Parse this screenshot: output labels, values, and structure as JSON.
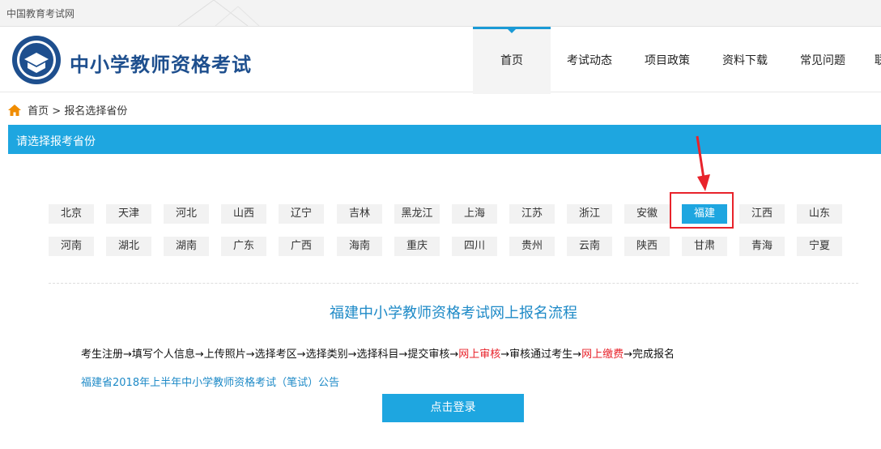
{
  "site_name": "中国教育考试网",
  "header": {
    "title": "中小学教师资格考试",
    "nav": [
      "首页",
      "考试动态",
      "项目政策",
      "资料下载",
      "常见问题",
      "联"
    ]
  },
  "breadcrumb": {
    "home": "首页",
    "sep": ">",
    "current": "报名选择省份"
  },
  "section_title": "请选择报考省份",
  "provinces_row1": [
    "北京",
    "天津",
    "河北",
    "山西",
    "辽宁",
    "吉林",
    "黑龙江",
    "上海",
    "江苏",
    "浙江",
    "安徽",
    "福建",
    "江西",
    "山东"
  ],
  "provinces_row2": [
    "河南",
    "湖北",
    "湖南",
    "广东",
    "广西",
    "海南",
    "重庆",
    "四川",
    "贵州",
    "云南",
    "陕西",
    "甘肃",
    "青海",
    "宁夏"
  ],
  "selected_province": "福建",
  "colors": {
    "accent": "#1ea6e0",
    "highlight": "#e8232b",
    "title_blue": "#1e4f8e"
  },
  "flow": {
    "title": "福建中小学教师资格考试网上报名流程",
    "part1": "考生注册→填写个人信息→上传照片→选择考区→选择类别→选择科目→提交审核→",
    "red1": "网上审核",
    "part2": "→审核通过考生→",
    "red2": "网上缴费",
    "part3": "→完成报名"
  },
  "notice_link": "福建省2018年上半年中小学教师资格考试（笔试）公告",
  "login_button": "点击登录"
}
